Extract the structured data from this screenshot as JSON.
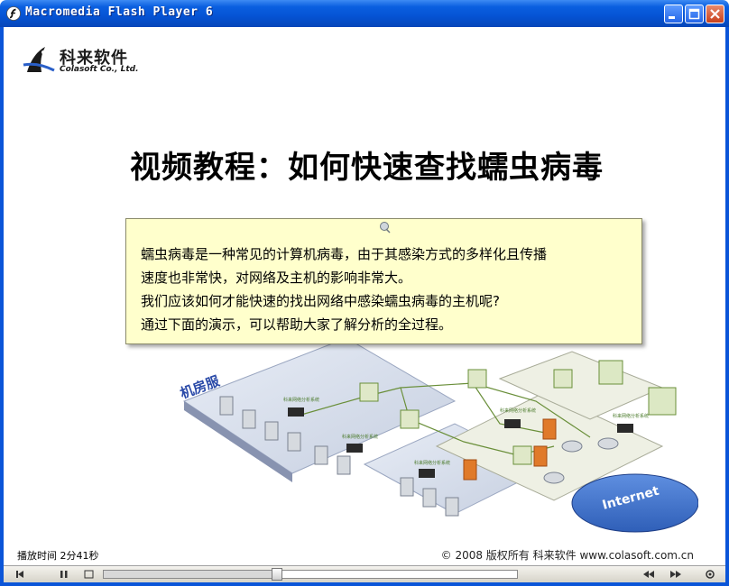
{
  "window": {
    "title": "Macromedia Flash Player 6",
    "accent": "#0b55d8"
  },
  "logo": {
    "name": "科来软件",
    "sub": "Colasoft Co., Ltd."
  },
  "slide": {
    "headline": "视频教程：如何快速查找蠕虫病毒",
    "note_lines": [
      "蠕虫病毒是一种常见的计算机病毒，由于其感染方式的多样化且传播",
      "速度也非常快，对网络及主机的影响非常大。",
      "我们应该如何才能快速的找出网络中感染蠕虫病毒的主机呢?",
      "通过下面的演示，可以帮助大家了解分析的全过程。"
    ],
    "diagram_labels": {
      "room": "机房服",
      "internet": "Internet",
      "system_label": "科来网络分析系统"
    }
  },
  "status": {
    "play_time": "播放时间  2分41秒",
    "copyright": "© 2008 版权所有  科来软件 www.colasoft.com.cn"
  },
  "controls": {
    "progress": 0.42
  }
}
